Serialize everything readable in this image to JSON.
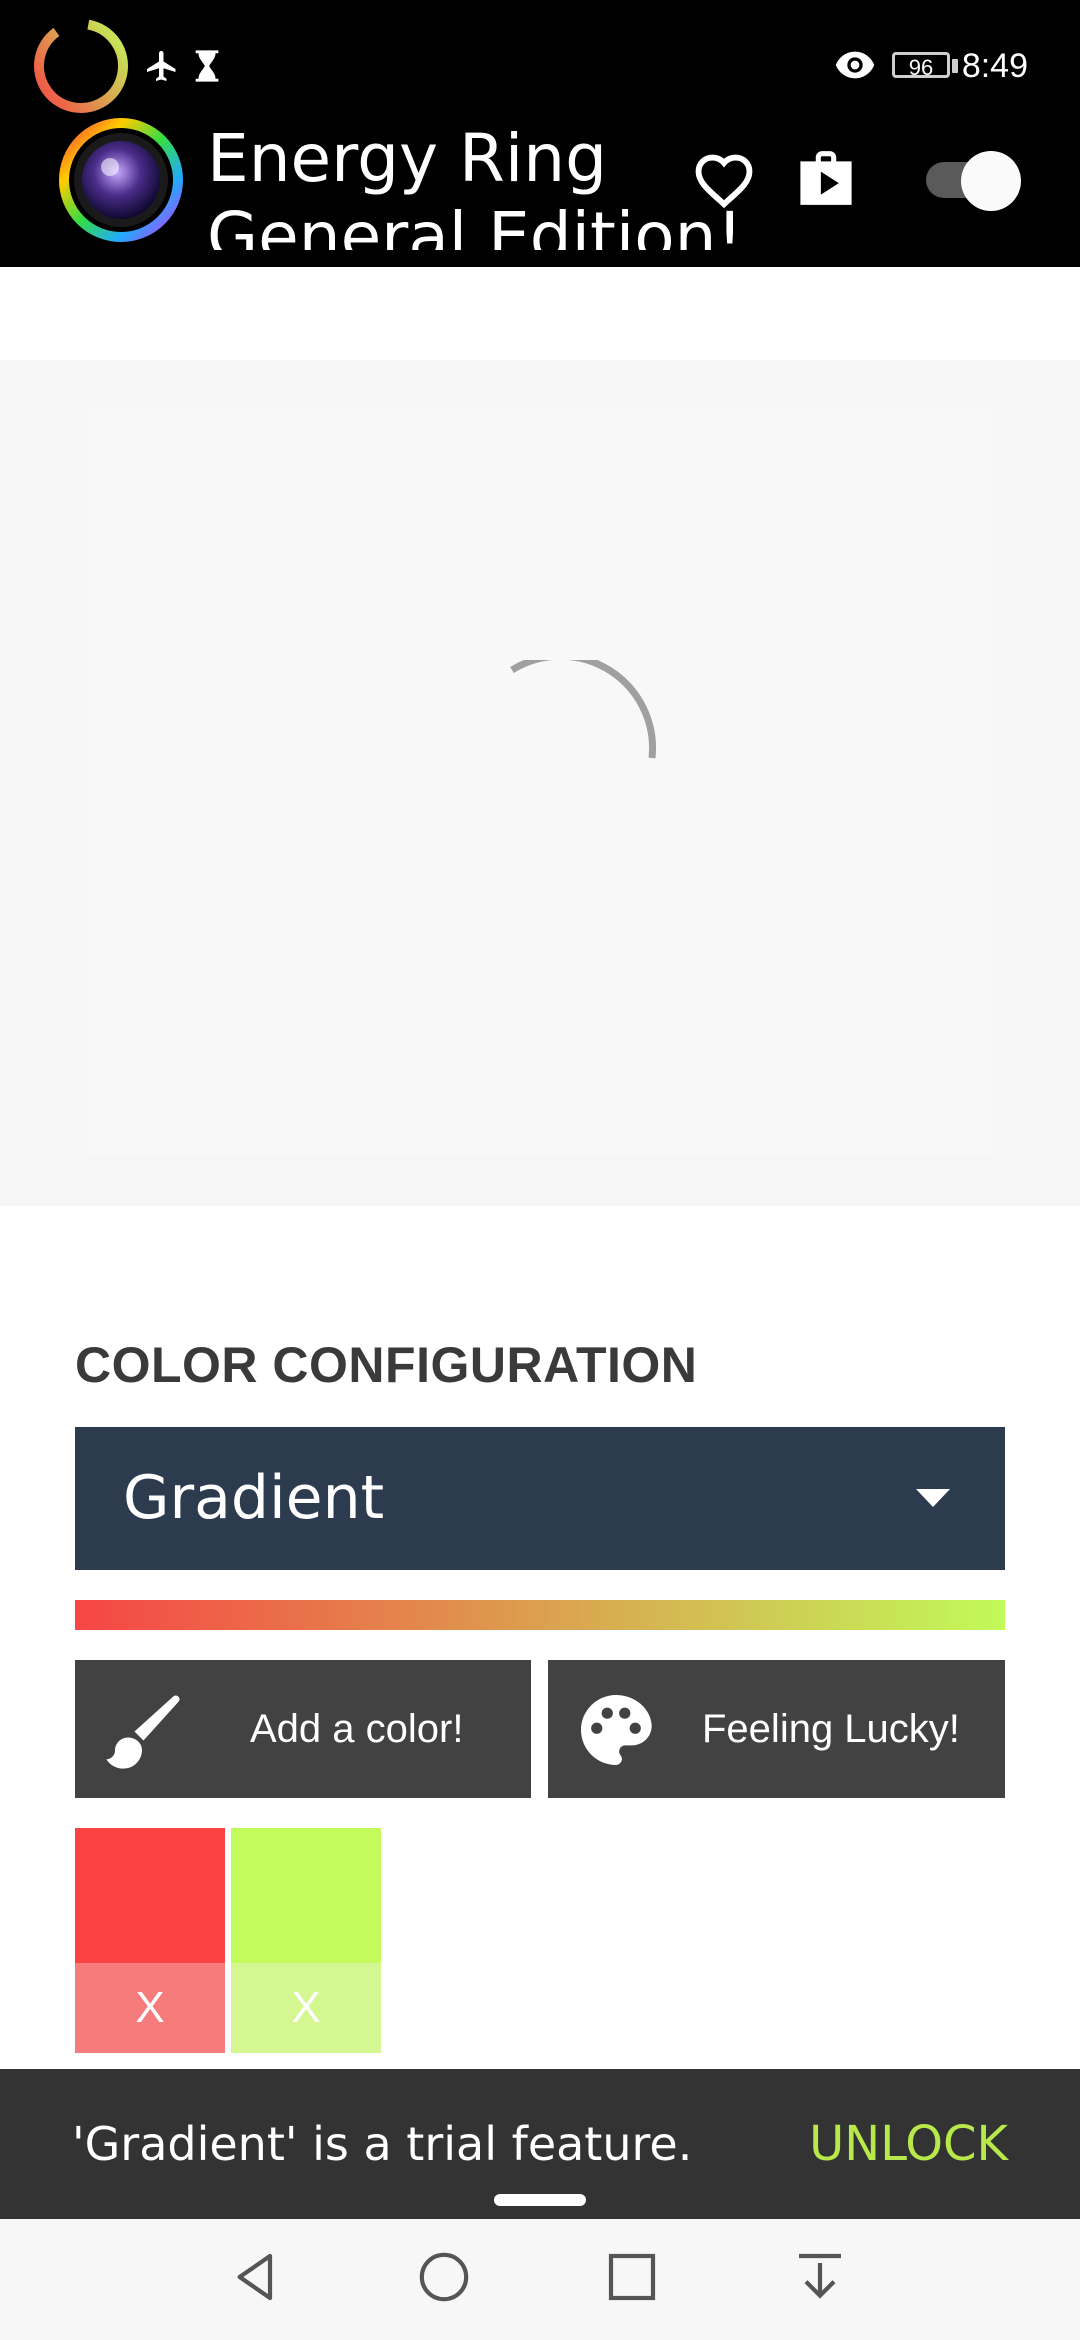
{
  "status_bar": {
    "time": "8:49",
    "battery": "96",
    "icons": [
      "energy-ring-icon",
      "airplane-icon",
      "hourglass-icon",
      "eye-icon"
    ]
  },
  "app_bar": {
    "title_line1": "Energy Ring",
    "title_line2": "General Edition!",
    "icons": [
      "app-logo",
      "heart-icon",
      "play-store-icon",
      "toggle-switch"
    ]
  },
  "preview": {
    "state": "loading"
  },
  "color_config": {
    "section_title": "COLOR CONFIGURATION",
    "dropdown_value": "Gradient",
    "gradient_colors": [
      "#f64545",
      "#c1fa59"
    ],
    "buttons": [
      {
        "label": "Add a color!",
        "icon": "paintbrush-icon"
      },
      {
        "label": "Feeling Lucky!",
        "icon": "palette-icon"
      }
    ],
    "swatches": [
      {
        "color": "#fb4343",
        "remove_label": "X",
        "remove_color": "#f67b7b"
      },
      {
        "color": "#c4fb5c",
        "remove_label": "X",
        "remove_color": "#d5f792"
      }
    ]
  },
  "snackbar": {
    "message": "'Gradient' is a trial feature.",
    "action": "UNLOCK"
  },
  "nav_bar": {
    "icons": [
      "back-icon",
      "home-icon",
      "recents-icon",
      "notification-pulldown-icon"
    ]
  }
}
